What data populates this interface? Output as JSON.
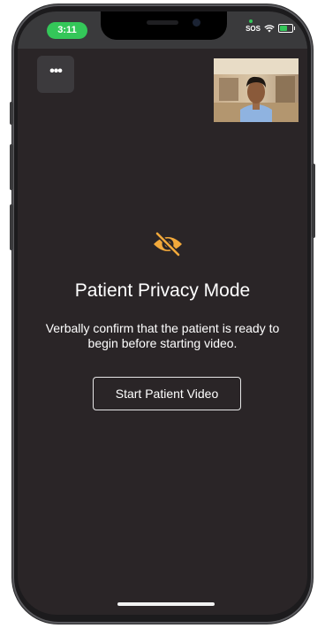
{
  "status_bar": {
    "time": "3:11",
    "carrier": "SOS"
  },
  "menu": {
    "label": "•••"
  },
  "video_preview": {
    "description_icon": "self-video-thumbnail"
  },
  "privacy": {
    "icon": "eye-slash-icon",
    "icon_color": "#f2a93b",
    "title": "Patient Privacy Mode",
    "message": "Verbally confirm that the patient is ready to begin before starting video.",
    "button_label": "Start Patient Video"
  },
  "colors": {
    "background": "#2a2527",
    "status_green": "#34c759",
    "text": "#ffffff"
  }
}
